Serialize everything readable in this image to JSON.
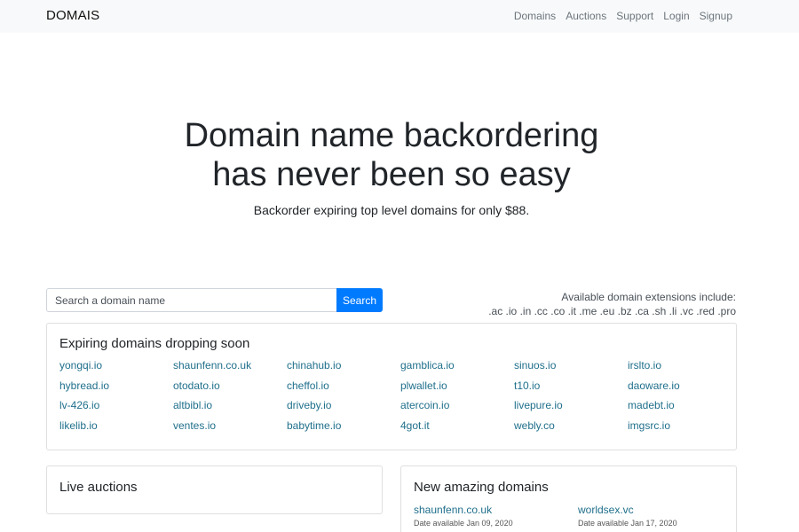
{
  "navbar": {
    "brand": "DOMAIS",
    "links": [
      "Domains",
      "Auctions",
      "Support",
      "Login",
      "Signup"
    ]
  },
  "hero": {
    "title_line1": "Domain name backordering",
    "title_line2": "has never been so easy",
    "subtitle": "Backorder expiring top level domains for only $88."
  },
  "search": {
    "placeholder": "Search a domain name",
    "button_label": "Search"
  },
  "extensions": {
    "label": "Available domain extensions include:",
    "list": ".ac .io .in .cc .co .it .me .eu .bz .ca .sh .li .vc .red .pro"
  },
  "expiring": {
    "title": "Expiring domains dropping soon",
    "domains": [
      "yongqi.io",
      "shaunfenn.co.uk",
      "chinahub.io",
      "gamblica.io",
      "sinuos.io",
      "irslto.io",
      "hybread.io",
      "otodato.io",
      "cheffol.io",
      "plwallet.io",
      "t10.io",
      "daoware.io",
      "lv-426.io",
      "altbibl.io",
      "driveby.io",
      "atercoin.io",
      "livepure.io",
      "madebt.io",
      "likelib.io",
      "ventes.io",
      "babytime.io",
      "4got.it",
      "webly.co",
      "imgsrc.io"
    ]
  },
  "live_auctions": {
    "title": "Live auctions"
  },
  "amazing": {
    "title": "New amazing domains",
    "items": [
      {
        "name": "shaunfenn.co.uk",
        "date": "Date available Jan 09, 2020"
      },
      {
        "name": "worldsex.vc",
        "date": "Date available Jan 17, 2020"
      }
    ]
  },
  "colors": {
    "navbar_bg": "#f8f9fa",
    "primary": "#007bff",
    "link": "#1f6f8b"
  }
}
